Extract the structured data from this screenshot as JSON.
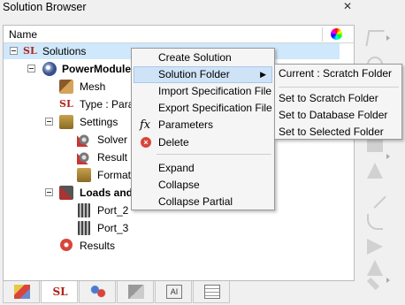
{
  "window": {
    "title": "Solution Browser",
    "close": "✕"
  },
  "header": {
    "name_column": "Name"
  },
  "tree": {
    "solutions": "Solutions",
    "powermodule": "PowerModule",
    "mesh": "Mesh",
    "type": "Type : Paras",
    "settings": "Settings",
    "solver": "Solver S",
    "result": "Result F",
    "format": "Format a",
    "loads": "Loads and",
    "port2": "Port_2",
    "port3": "Port_3",
    "results": "Results",
    "icon_glyph": "SL"
  },
  "context_menu": {
    "create_solution": "Create Solution",
    "solution_folder": "Solution Folder",
    "import_spec": "Import Specification File",
    "export_spec": "Export Specification File",
    "parameters": "Parameters",
    "parameters_glyph": "fx",
    "delete": "Delete",
    "delete_glyph": "×",
    "expand": "Expand",
    "collapse": "Collapse",
    "collapse_partial": "Collapse Partial",
    "submenu_arrow": "▶"
  },
  "submenu": {
    "current": "Current : Scratch Folder",
    "scratch": "Set to Scratch Folder",
    "database": "Set to Database Folder",
    "selected": "Set to Selected Folder"
  },
  "tabs": {
    "ai_label": "AI"
  },
  "toolbar": {
    "icons": [
      "select-arrow-icon",
      "rotate-icon",
      "box-icon",
      "sphere-icon",
      "point-icon",
      "line-icon",
      "curve-icon",
      "plane-icon",
      "wedge-icon",
      "solid-icon",
      "arrow-icon",
      "cube-icon"
    ]
  }
}
